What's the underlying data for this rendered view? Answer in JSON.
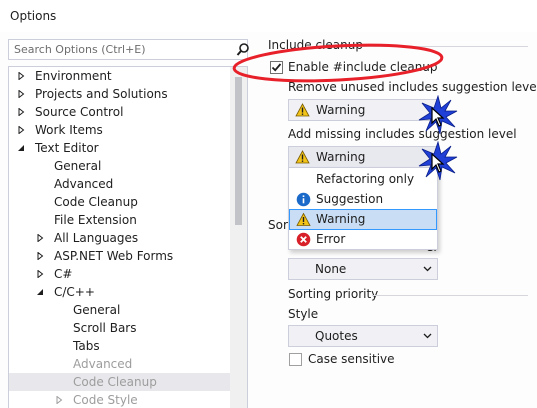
{
  "window": {
    "title": "Options"
  },
  "search": {
    "placeholder": "Search Options (Ctrl+E)"
  },
  "tree": {
    "items": [
      {
        "label": "Environment",
        "expander": "collapsed"
      },
      {
        "label": "Projects and Solutions",
        "expander": "collapsed"
      },
      {
        "label": "Source Control",
        "expander": "collapsed"
      },
      {
        "label": "Work Items",
        "expander": "collapsed"
      },
      {
        "label": "Text Editor",
        "expander": "expanded"
      },
      {
        "label": "General",
        "expander": "none"
      },
      {
        "label": "Advanced",
        "expander": "none"
      },
      {
        "label": "Code Cleanup",
        "expander": "none"
      },
      {
        "label": "File Extension",
        "expander": "none"
      },
      {
        "label": "All Languages",
        "expander": "collapsed"
      },
      {
        "label": "ASP.NET Web Forms",
        "expander": "collapsed"
      },
      {
        "label": "C#",
        "expander": "collapsed"
      },
      {
        "label": "C/C++",
        "expander": "expanded"
      },
      {
        "label": "General",
        "expander": "none"
      },
      {
        "label": "Scroll Bars",
        "expander": "none"
      },
      {
        "label": "Tabs",
        "expander": "none"
      },
      {
        "label": "Advanced",
        "expander": "none"
      },
      {
        "label": "Code Cleanup",
        "expander": "none",
        "selected": true
      },
      {
        "label": "Code Style",
        "expander": "collapsed"
      }
    ]
  },
  "include_cleanup": {
    "header": "Include cleanup",
    "enable_label": "Enable #include cleanup",
    "enable_checked": true,
    "remove_unused_label": "Remove unused includes suggestion level",
    "remove_unused_value": "Warning",
    "add_missing_label": "Add missing includes suggestion level",
    "add_missing_value": "Warning"
  },
  "dropdown": {
    "options": [
      {
        "label": "Refactoring only",
        "icon": "none"
      },
      {
        "label": "Suggestion",
        "icon": "info-icon"
      },
      {
        "label": "Warning",
        "icon": "warning-icon",
        "highlighted": true
      },
      {
        "label": "Error",
        "icon": "error-icon"
      }
    ]
  },
  "sorting": {
    "header_partial": "Sort",
    "level_label_partial": "el",
    "level_value": "None",
    "priority_header": "Sorting priority",
    "style_label": "Style",
    "style_value": "Quotes",
    "case_sensitive_label": "Case sensitive",
    "case_sensitive_checked": false
  },
  "colors": {
    "ellipse": "#e8202a",
    "burst": "#1f3fd6",
    "highlight": "#c9def5",
    "warning": "#f2c318",
    "info": "#1b6ac9",
    "error": "#d8202a"
  }
}
